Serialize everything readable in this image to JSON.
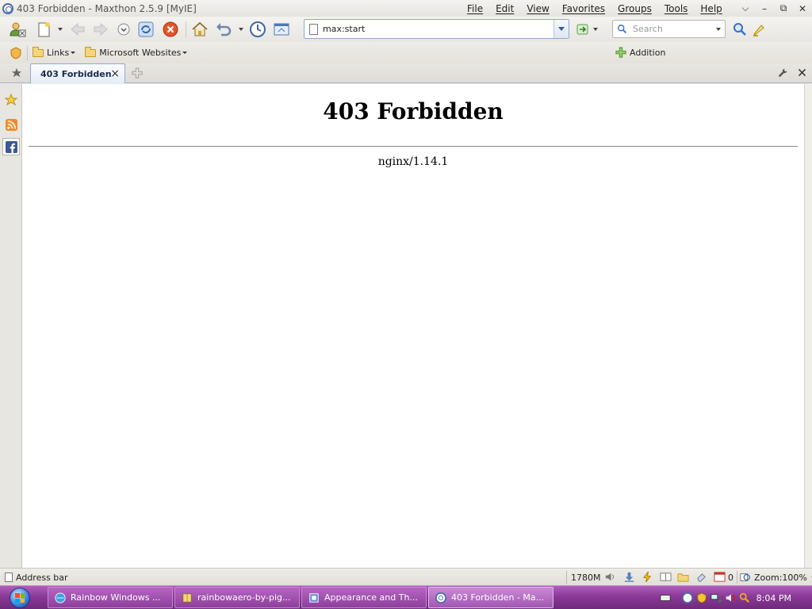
{
  "window": {
    "title": "403 Forbidden - Maxthon 2.5.9 [MyIE]",
    "controls": [
      "⌵",
      "–",
      "⧉",
      "✕"
    ]
  },
  "menu": [
    "File",
    "Edit",
    "View",
    "Favorites",
    "Groups",
    "Tools",
    "Help"
  ],
  "toolbar": {
    "address_value": "max:start",
    "search_placeholder": "Search"
  },
  "linksbar": {
    "items": [
      "Links",
      "Microsoft Websites"
    ],
    "addition_label": "Addition"
  },
  "tabs": [
    {
      "label": "403 Forbidden",
      "close": "×"
    }
  ],
  "page": {
    "heading": "403 Forbidden",
    "server": "nginx/1.14.1"
  },
  "statusbar": {
    "text": "Address bar",
    "memory": "1780M",
    "popup_count": "0",
    "zoom": "Zoom:100%"
  },
  "taskbar": {
    "tasks": [
      {
        "label": "Rainbow Windows ..."
      },
      {
        "label": "rainbowaero-by-pig..."
      },
      {
        "label": "Appearance and Th..."
      },
      {
        "label": "403 Forbidden - Ma..."
      }
    ],
    "clock": "8:04 PM"
  },
  "colors": {
    "taskbar": "#8a3a96",
    "accent": "#3a6fc4",
    "stop": "#e0552c"
  }
}
